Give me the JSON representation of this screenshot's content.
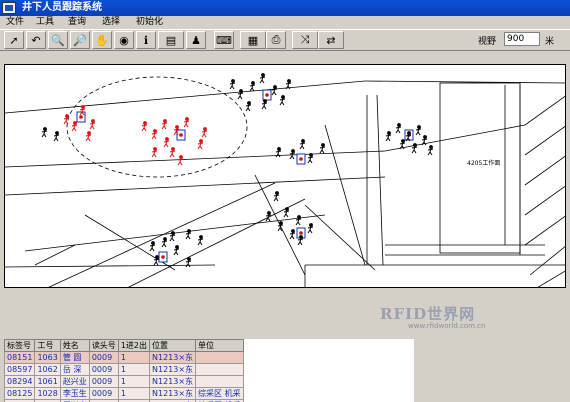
{
  "window": {
    "title": "井下人员跟踪系统"
  },
  "menu": [
    "文件",
    "工具",
    "查询",
    "选择",
    "初始化"
  ],
  "toolbar": {
    "buttons": [
      {
        "name": "pointer-tool-button",
        "glyph": "➚"
      },
      {
        "name": "undo-button",
        "glyph": "↶"
      },
      {
        "name": "zoom-in-button",
        "glyph": "🔍"
      },
      {
        "name": "zoom-out-button",
        "glyph": "🔎"
      },
      {
        "name": "pan-hand-button",
        "glyph": "✋"
      },
      {
        "name": "target-button",
        "glyph": "◉"
      },
      {
        "name": "info-button",
        "glyph": "ℹ"
      },
      {
        "name": "layer-button",
        "glyph": "▤"
      },
      {
        "name": "person-button",
        "glyph": "♟"
      },
      {
        "name": "keyboard-button",
        "glyph": "⌨"
      },
      {
        "name": "book-button",
        "glyph": "▦"
      },
      {
        "name": "print-button",
        "glyph": "⎙"
      },
      {
        "name": "route-button",
        "glyph": "⤨"
      },
      {
        "name": "exit-button",
        "glyph": "⇄"
      }
    ],
    "zoom_label": "视野",
    "zoom_value": "900",
    "zoom_unit": "米"
  },
  "map": {
    "labels": {
      "workface": "4205工作面"
    },
    "workers_red": 16,
    "workers_black": 40
  },
  "table": {
    "headers": [
      "标签号",
      "工号",
      "姓名",
      "读头号",
      "1进2出",
      "位置",
      "单位"
    ],
    "rows": [
      [
        "08151",
        "1063",
        "管 圆",
        "0009",
        "1",
        "N1213×东",
        ""
      ],
      [
        "08597",
        "1062",
        "岳 深",
        "0009",
        "1",
        "N1213×东",
        ""
      ],
      [
        "08294",
        "1061",
        "赵兴业",
        "0009",
        "1",
        "N1213×东",
        ""
      ],
      [
        "08125",
        "1028",
        "李玉生",
        "0009",
        "1",
        "N1213×东",
        "综采区 机采"
      ],
      [
        "08295",
        "1027",
        "周兴忠",
        "0009",
        "1",
        "N1213×东",
        "综采区 机采"
      ]
    ]
  },
  "watermark": {
    "main": "RFID世界网",
    "sub": "www.rfidworld.com.cn"
  }
}
